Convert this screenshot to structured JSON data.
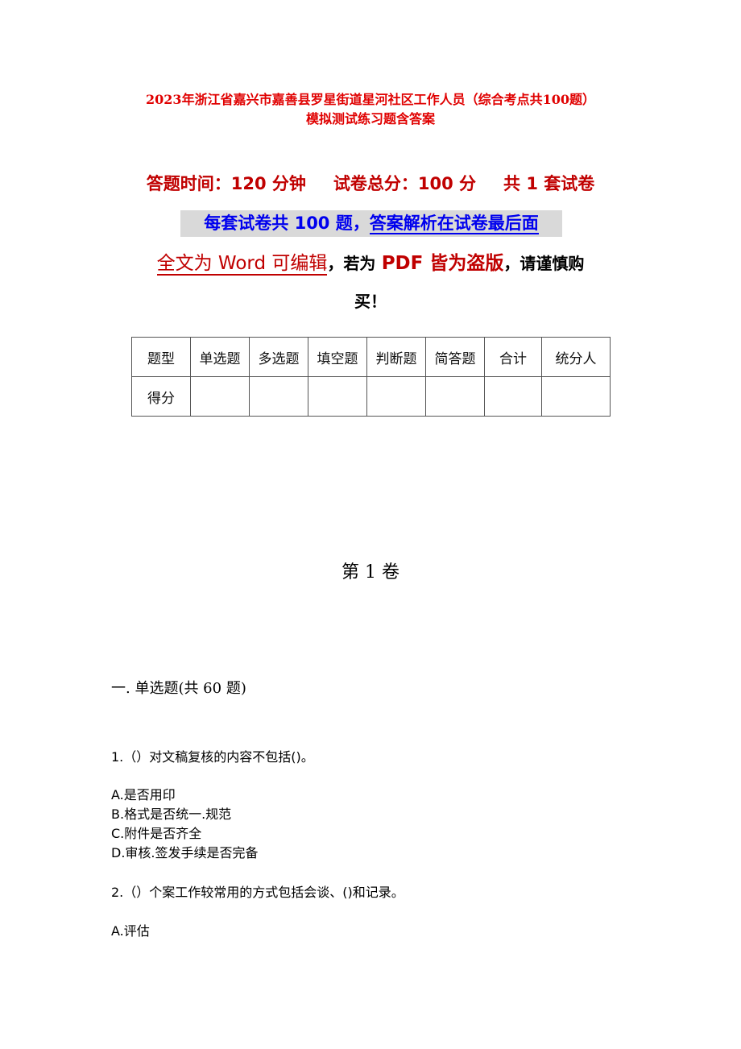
{
  "header": {
    "title_line1": "2023年浙江省嘉兴市嘉善县罗星街道星河社区工作人员（综合考点共100题）",
    "title_line2": "模拟测试练习题含答案"
  },
  "exam_info": {
    "time": "答题时间：120 分钟",
    "total_score": "试卷总分：100 分",
    "sets": "共 1 套试卷"
  },
  "notice": {
    "blue_part1": "每套试卷共 100 题，",
    "blue_part2": "答案解析在试卷最后面",
    "editable": "全文为 Word 可编辑",
    "comma1": "，",
    "if_pdf": "若为",
    "pdf_pirated": "PDF 皆为盗版",
    "comma2": "，",
    "caution": "请谨慎购",
    "buy": "买！"
  },
  "score_table": {
    "headers": [
      "题型",
      "单选题",
      "多选题",
      "填空题",
      "判断题",
      "简答题",
      "合计",
      "统分人"
    ],
    "row_label": "得分",
    "row_values": [
      "",
      "",
      "",
      "",
      "",
      "",
      ""
    ]
  },
  "volume_title": "第 1 卷",
  "section_title": "一. 单选题(共 60 题)",
  "questions": [
    {
      "stem": "1.（）对文稿复核的内容不包括()。",
      "options": [
        "A.是否用印",
        "B.格式是否统一.规范",
        "C.附件是否齐全",
        "D.审核.签发手续是否完备"
      ]
    },
    {
      "stem": "2.（）个案工作较常用的方式包括会谈、()和记录。",
      "options": [
        "A.评估"
      ]
    }
  ]
}
